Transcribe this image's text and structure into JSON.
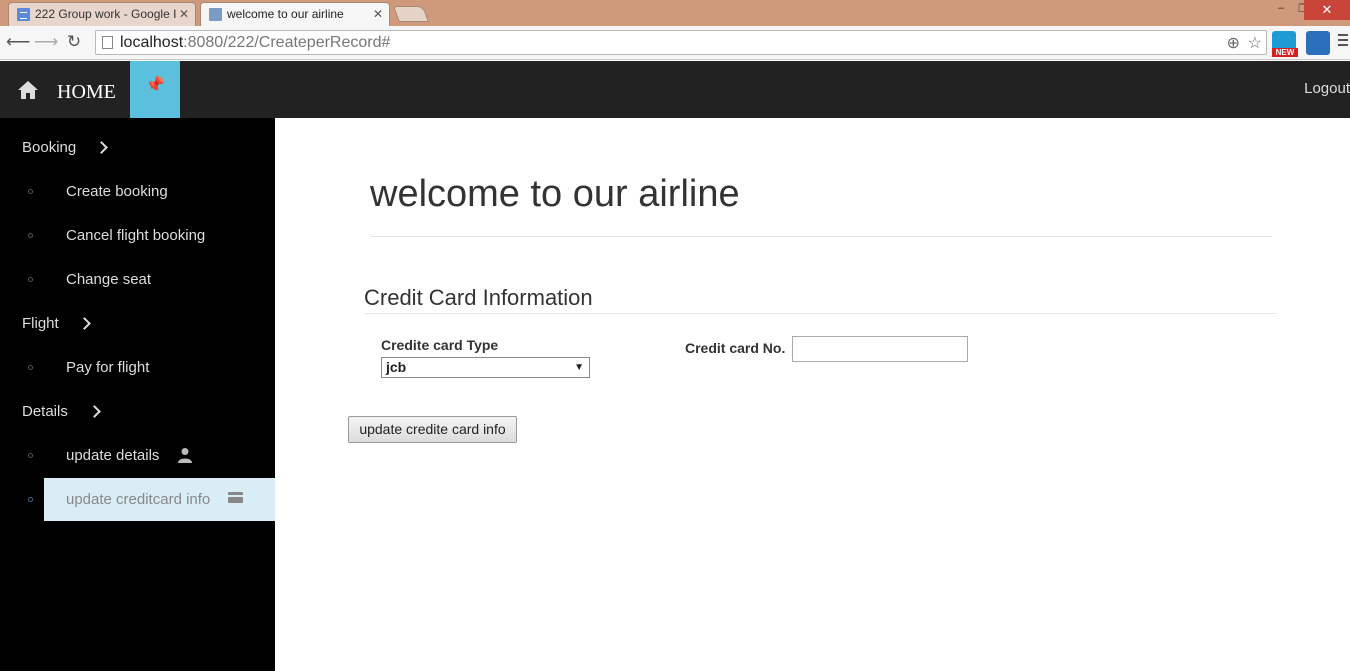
{
  "browser": {
    "tabs": [
      {
        "title": "222 Group work - Google I"
      },
      {
        "title": "welcome to our airline"
      }
    ],
    "tab_close_glyph": "✕",
    "url_host": "localhost",
    "url_rest": ":8080/222/CreateperRecord#",
    "window_controls": {
      "minimize": "–",
      "restore": "❐",
      "close": "✕"
    },
    "extension_badge": "NEW"
  },
  "navbar": {
    "home_label": "HOME",
    "logout_label": "Logout"
  },
  "sidebar": {
    "sections": [
      {
        "label": "Booking"
      },
      {
        "label": "Flight"
      },
      {
        "label": "Details"
      }
    ],
    "items": [
      {
        "label": "Create booking"
      },
      {
        "label": "Cancel flight booking"
      },
      {
        "label": "Change seat"
      },
      {
        "label": "Pay for flight"
      },
      {
        "label": "update details"
      },
      {
        "label": "update creditcard info"
      }
    ]
  },
  "main": {
    "heading": "welcome to our airline",
    "legend": "Credit Card Information",
    "card_type_label": "Credite card Type",
    "card_type_value": "jcb",
    "card_no_label": "Credit card No.",
    "card_no_value": "",
    "submit_label": "update credite card info"
  },
  "colors": {
    "navbar_bg": "#222222",
    "accent_button": "#5bc0de",
    "sidebar_bg": "#000000",
    "active_item_bg": "#d9edf7"
  }
}
